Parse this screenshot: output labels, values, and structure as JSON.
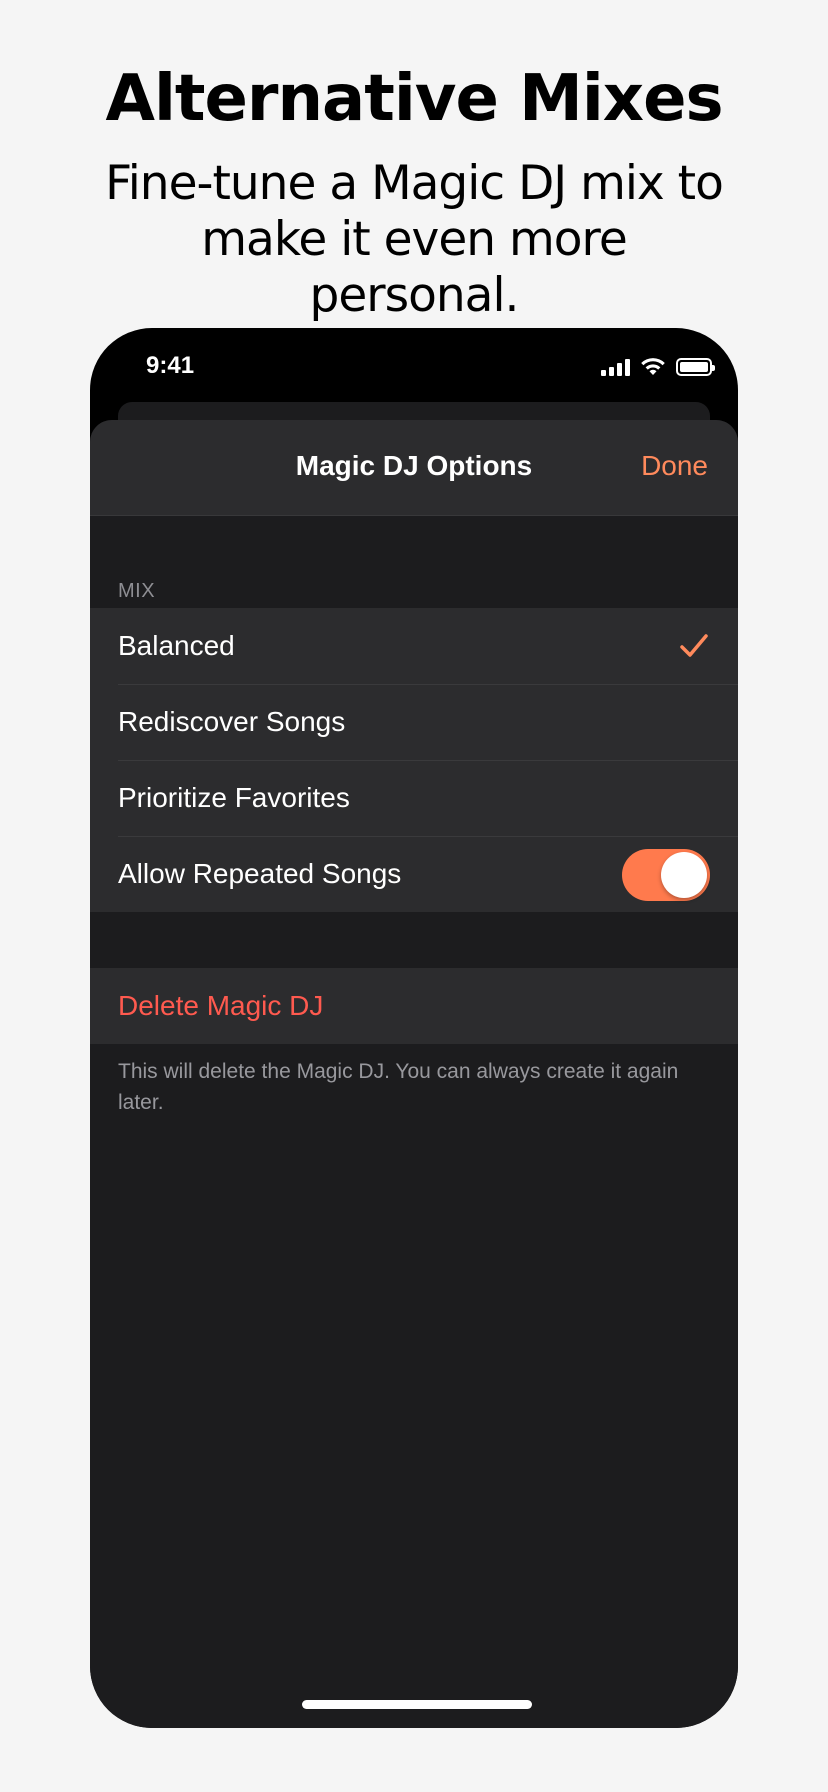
{
  "promo": {
    "title": "Alternative Mixes",
    "subtitle": "Fine-tune a Magic DJ mix to make it even more personal."
  },
  "status_bar": {
    "time": "9:41",
    "icons": [
      "cellular-signal-icon",
      "wifi-icon",
      "battery-icon"
    ]
  },
  "nav": {
    "title": "Magic DJ Options",
    "done_label": "Done"
  },
  "mix_section": {
    "header": "MIX",
    "options": [
      {
        "label": "Balanced",
        "selected": true
      },
      {
        "label": "Rediscover Songs",
        "selected": false
      },
      {
        "label": "Prioritize Favorites",
        "selected": false
      }
    ],
    "allow_repeated": {
      "label": "Allow Repeated Songs",
      "on": true
    }
  },
  "delete_section": {
    "label": "Delete Magic DJ",
    "note": "This will delete the Magic DJ. You can always create it again later."
  },
  "colors": {
    "accent": "#ff8a5c",
    "toggle_on": "#ff7a4d",
    "destructive": "#ff5a4f",
    "sheet_bg": "#1c1c1e",
    "cell_bg": "#2c2c2e"
  }
}
